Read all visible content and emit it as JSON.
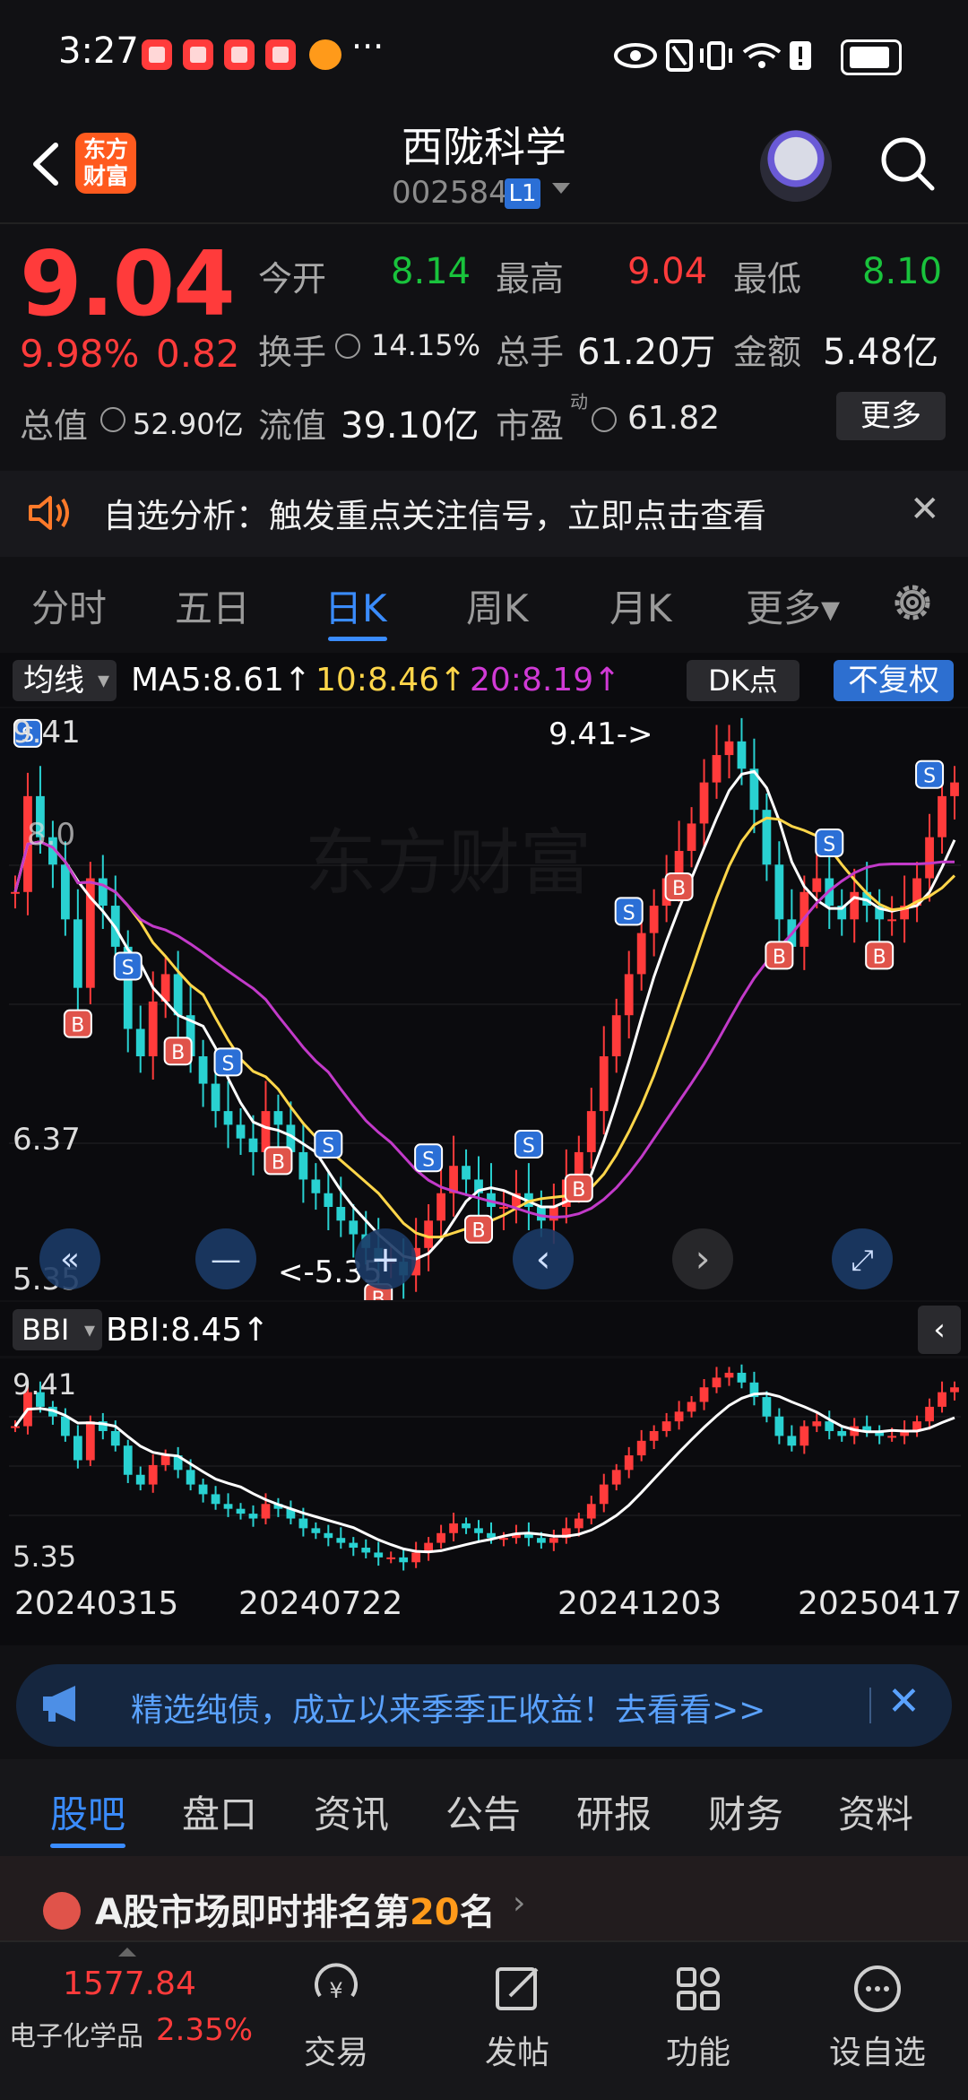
{
  "status_bar": {
    "time": "3:27",
    "dots": "···"
  },
  "header": {
    "logo_line1": "东方",
    "logo_line2": "财富",
    "stock_name": "西陇科学",
    "stock_code": "002584",
    "level_badge": "L1"
  },
  "quote": {
    "price": "9.04",
    "pct_change": "9.98%",
    "change": "0.82",
    "open_label": "今开",
    "open": "8.14",
    "high_label": "最高",
    "high": "9.04",
    "low_label": "最低",
    "low": "8.10",
    "turnover_label": "换手",
    "turnover": "14.15%",
    "volume_label": "总手",
    "volume": "61.20万",
    "amount_label": "金额",
    "amount": "5.48亿",
    "total_cap_label": "总值",
    "total_cap": "52.90亿",
    "float_cap_label": "流值",
    "float_cap": "39.10亿",
    "pe_label": "市盈",
    "pe_sup": "动",
    "pe": "61.82",
    "more_label": "更多"
  },
  "alert": {
    "text": "自选分析：触发重点关注信号，立即点击查看",
    "close": "✕"
  },
  "kline_tabs": [
    {
      "label": "分时"
    },
    {
      "label": "五日"
    },
    {
      "label": "日K"
    },
    {
      "label": "周K"
    },
    {
      "label": "月K"
    },
    {
      "label": "更多▾"
    }
  ],
  "indicators": {
    "ma_select": "均线",
    "ma5": "MA5:8.61↑",
    "ma10": "10:8.46↑",
    "ma20": "20:8.19↑",
    "dk_label": "DK点",
    "adjust_label": "不复权",
    "bbi_select": "BBI",
    "bbi_value": "BBI:8.45↑",
    "bbi_collapse": "‹"
  },
  "chart_data": {
    "type": "candlestick",
    "axis_top": "9.41",
    "axis_mid": "6.37",
    "axis_bottom": "5.35",
    "max_marker": "9.41->",
    "min_marker": "<-5.35",
    "partial_label": "8.0",
    "y_range": [
      5.35,
      9.41
    ],
    "dates": [
      "20240315",
      "20240722",
      "20241203",
      "20250417"
    ],
    "close_series": [
      8.2,
      8.9,
      8.6,
      8.4,
      8.0,
      7.5,
      8.3,
      8.1,
      7.8,
      7.2,
      7.0,
      7.4,
      7.6,
      7.3,
      7.0,
      6.8,
      6.6,
      6.5,
      6.4,
      6.3,
      6.6,
      6.5,
      6.3,
      6.1,
      6.0,
      5.9,
      5.8,
      5.7,
      5.6,
      5.5,
      5.5,
      5.4,
      5.6,
      5.8,
      6.0,
      6.2,
      6.1,
      6.0,
      5.9,
      5.9,
      6.0,
      5.9,
      5.8,
      5.9,
      6.1,
      6.3,
      6.6,
      7.0,
      7.3,
      7.6,
      7.9,
      8.1,
      8.3,
      8.5,
      8.7,
      9.0,
      9.2,
      9.3,
      9.1,
      8.8,
      8.4,
      8.0,
      7.8,
      8.2,
      8.3,
      8.1,
      8.0,
      8.2,
      8.1,
      8.0,
      8.0,
      8.1,
      8.3,
      8.6,
      8.9,
      9.0
    ],
    "signals": {
      "buy_label": "B",
      "sell_label": "S"
    }
  },
  "chart_controls": {
    "zoom_out": "«",
    "minus": "—",
    "plus": "+",
    "prev": "‹",
    "next": "›",
    "expand": "⤢"
  },
  "promo": {
    "text": "精选纯债，成立以来季季正收益！去看看>>",
    "close": "✕"
  },
  "bottom_tabs": [
    {
      "label": "股吧"
    },
    {
      "label": "盘口"
    },
    {
      "label": "资讯"
    },
    {
      "label": "公告"
    },
    {
      "label": "研报"
    },
    {
      "label": "财务"
    },
    {
      "label": "资料"
    }
  ],
  "rank": {
    "prefix": "A股市场即时排名第",
    "number": "20",
    "suffix": "名",
    "arrow": "›"
  },
  "index": {
    "value": "1577.84",
    "name": "电子化学品",
    "pct": "2.35%"
  },
  "nav": [
    {
      "label": "交易"
    },
    {
      "label": "发帖"
    },
    {
      "label": "功能"
    },
    {
      "label": "设自选"
    }
  ]
}
